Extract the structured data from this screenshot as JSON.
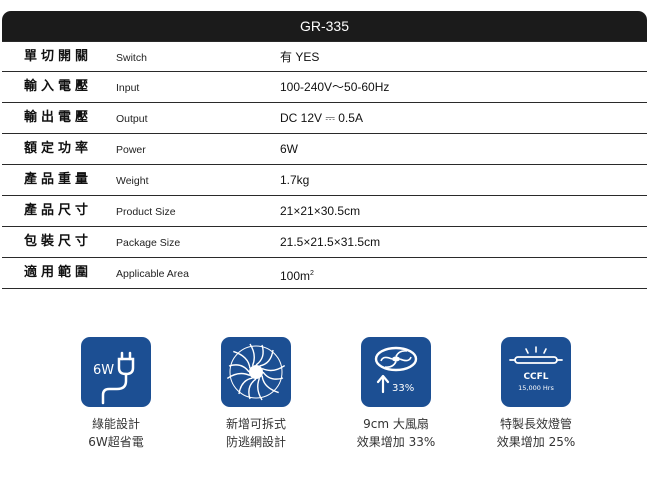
{
  "header": {
    "title": "GR-335"
  },
  "specs": [
    {
      "label_zh": "單切開關",
      "label_en": "Switch",
      "value": "有 YES"
    },
    {
      "label_zh": "輸入電壓",
      "label_en": "Input",
      "value": "100-240V～50-60Hz"
    },
    {
      "label_zh": "輸出電壓",
      "label_en": "Output",
      "value": "DC 12V ⎓ 0.5A"
    },
    {
      "label_zh": "額定功率",
      "label_en": "Power",
      "value": "6W"
    },
    {
      "label_zh": "產品重量",
      "label_en": "Weight",
      "value": "1.7kg"
    },
    {
      "label_zh": "產品尺寸",
      "label_en": "Product Size",
      "value": "21×21×30.5cm"
    },
    {
      "label_zh": "包裝尺寸",
      "label_en": "Package Size",
      "value": "21.5×21.5×31.5cm"
    },
    {
      "label_zh": "適用範圍",
      "label_en": "Applicable Area",
      "value": "100m",
      "value_sup": "2"
    }
  ],
  "features": [
    {
      "icon": "power-plug-icon",
      "icon_text": "6W",
      "line1": "綠能設計",
      "line2": "6W超省電"
    },
    {
      "icon": "fan-blade-icon",
      "line1": "新增可拆式",
      "line2": "防逃網設計"
    },
    {
      "icon": "fan-upgrade-icon",
      "icon_text": "33%",
      "line1": "9cm 大風扇",
      "line2": "效果增加 33%"
    },
    {
      "icon": "ccfl-lamp-icon",
      "icon_text": "CCFL",
      "icon_subtext": "15,000 Hrs",
      "line1": "特製長效燈管",
      "line2": "效果增加 25%"
    }
  ],
  "colors": {
    "header_bg": "#1b1b1b",
    "icon_bg": "#1c4f93",
    "row_border": "#2a2a2a"
  }
}
